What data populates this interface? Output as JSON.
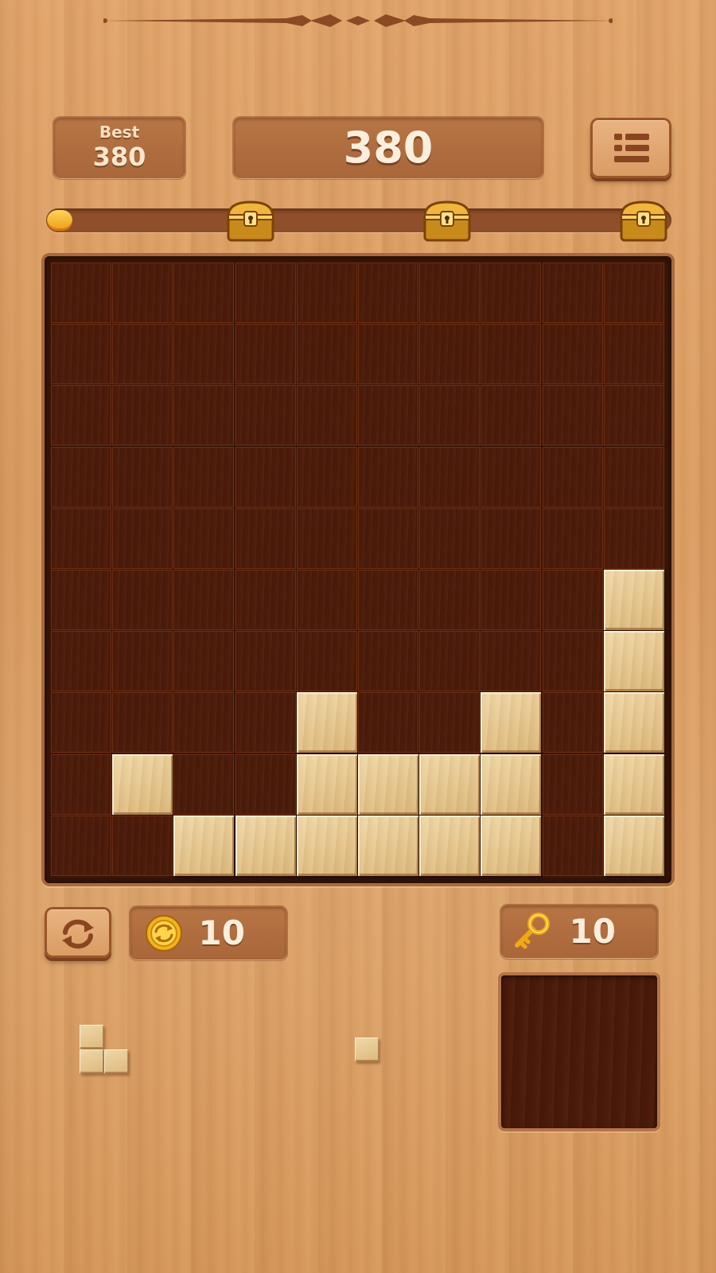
{
  "header": {
    "best_label": "Best",
    "best_value": "380",
    "score": "380",
    "menu_icon": "menu-list-icon"
  },
  "progress": {
    "fraction": 0.03,
    "rewards": [
      "treasure-chest-icon",
      "treasure-chest-icon",
      "treasure-chest-icon"
    ]
  },
  "board": {
    "rows": 10,
    "cols": 10,
    "filled": [
      [
        5,
        9
      ],
      [
        6,
        9
      ],
      [
        7,
        4
      ],
      [
        7,
        7
      ],
      [
        7,
        9
      ],
      [
        8,
        1
      ],
      [
        8,
        4
      ],
      [
        8,
        5
      ],
      [
        8,
        6
      ],
      [
        8,
        7
      ],
      [
        8,
        9
      ],
      [
        9,
        2
      ],
      [
        9,
        3
      ],
      [
        9,
        4
      ],
      [
        9,
        5
      ],
      [
        9,
        6
      ],
      [
        9,
        7
      ],
      [
        9,
        9
      ]
    ]
  },
  "footer": {
    "refresh_icon": "refresh-icon",
    "coins": "10",
    "coin_icon": "coin-refresh-icon",
    "keys": "10",
    "key_icon": "key-icon"
  },
  "pieces": [
    {
      "name": "corner-piece",
      "cells": [
        [
          0,
          0
        ],
        [
          1,
          0
        ],
        [
          1,
          1
        ]
      ]
    },
    {
      "name": "single-piece",
      "cells": [
        [
          0,
          0
        ]
      ]
    }
  ],
  "colors": {
    "board_empty": "#4c1b0a",
    "block": "#e3c38a",
    "progress_fill": "#f5a623",
    "background_wood": "#dca36b"
  }
}
